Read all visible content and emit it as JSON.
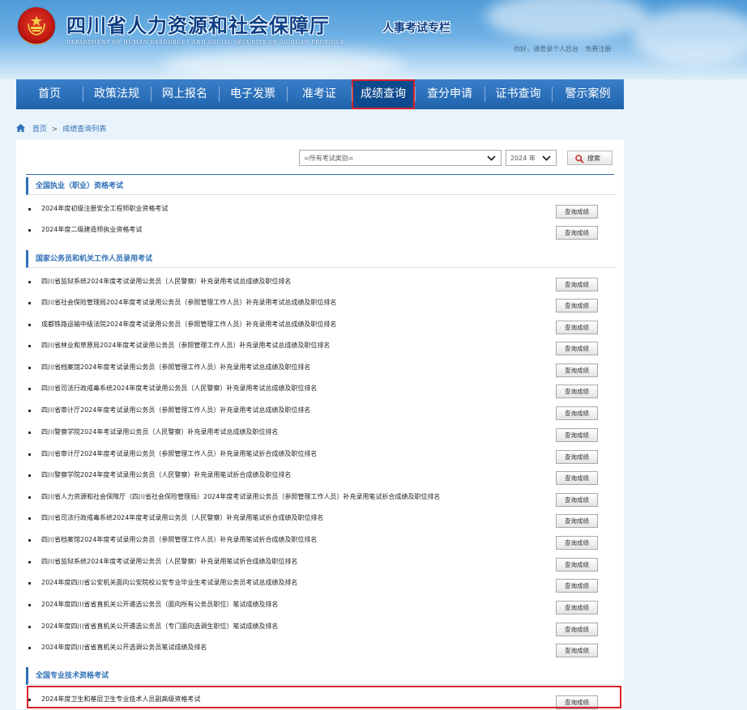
{
  "header": {
    "site_title": "四川省人力资源和社会保障厅",
    "site_subtitle": "DEPARTMENT OF HUMAN RESOURCES AND SOCIAL SECURITY OF SICHUAN PROVINCE",
    "column_name": "人事考试专栏",
    "greeting": "你好，请登录个人后台",
    "register": "免费注册"
  },
  "nav": {
    "items": [
      {
        "label": "首页"
      },
      {
        "label": "政策法规"
      },
      {
        "label": "网上报名"
      },
      {
        "label": "电子发票"
      },
      {
        "label": "准考证"
      },
      {
        "label": "成绩查询"
      },
      {
        "label": "查分申请"
      },
      {
        "label": "证书查询"
      },
      {
        "label": "警示案例"
      }
    ],
    "active": "成绩查询"
  },
  "breadcrumb": {
    "home": "首页",
    "separator": ">",
    "current": "成绩查询列表"
  },
  "filters": {
    "category_selected": "=所有考试类别=",
    "year_selected": "2024 年",
    "search_label": "搜索"
  },
  "query_button_label": "查询成绩",
  "sections": [
    {
      "title": "全国执业（职业）资格考试",
      "items": [
        "2024年度初级注册安全工程师职业资格考试",
        "2024年度二级建造师执业资格考试"
      ]
    },
    {
      "title": "国家公务员和机关工作人员录用考试",
      "items": [
        "四川省监狱系统2024年度考试录用公务员（人民警察）补充录用考试总成绩及职位排名",
        "四川省社会保险管理局2024年度考试录用公务员（参照管理工作人员）补充录用考试总成绩及职位排名",
        "成都铁路运输中级法院2024年度考试录用公务员（参照管理工作人员）补充录用考试总成绩及职位排名",
        "四川省林业和草原局2024年度考试录用公务员（参照管理工作人员）补充录用考试总成绩及职位排名",
        "四川省档案馆2024年度考试录用公务员（参照管理工作人员）补充录用考试总成绩及职位排名",
        "四川省司法行政戒毒系统2024年度考试录用公务员（人民警察）补充录用考试总成绩及职位排名",
        "四川省审计厅2024年度考试录用公务员（参照管理工作人员）补充录用考试总成绩及职位排名",
        "四川警察学院2024年考试录用公务员（人民警察）补充录用考试总成绩及职位排名",
        "四川省审计厅2024年度考试录用公务员（参照管理工作人员）补充录用笔试折合成绩及职位排名",
        "四川警察学院2024年度考试录用公务员（人民警察）补充录用笔试折合成绩及职位排名",
        "四川省人力资源和社会保障厅（四川省社会保险管理局）2024年度考试录用公务员（参照管理工作人员）补充录用笔试折合成绩及职位排名",
        "四川省司法行政戒毒系统2024年度考试录用公务员（人民警察）补充录用笔试折合成绩及职位排名",
        "四川省档案馆2024年度考试录用公务员（参照管理工作人员）补充录用笔试折合成绩及职位排名",
        "四川省监狱系统2024年度考试录用公务员（人民警察）补充录用笔试折合成绩及职位排名",
        "2024年度四川省公安机关面向公安院校公安专业毕业生考试录用公务员考试总成绩及排名",
        "2024年度四川省省直机关公开遴选公务员（面向所有公务员职位）笔试成绩及排名",
        "2024年度四川省省直机关公开遴选公务员（专门面向选调生职位）笔试成绩及排名",
        "2024年度四川省省直机关公开选调公务员笔试成绩及排名"
      ]
    },
    {
      "title": "全国专业技术资格考试",
      "items": [
        "2024年度卫生和基层卫生专业技术人员副高级资格考试"
      ]
    }
  ],
  "colors": {
    "nav_bg": "#1f63ad",
    "nav_active_bg": "#0f4a8f",
    "highlight_red": "#d8212a",
    "section_blue": "#2f6fb5",
    "page_bg": "#e9f3fb"
  }
}
